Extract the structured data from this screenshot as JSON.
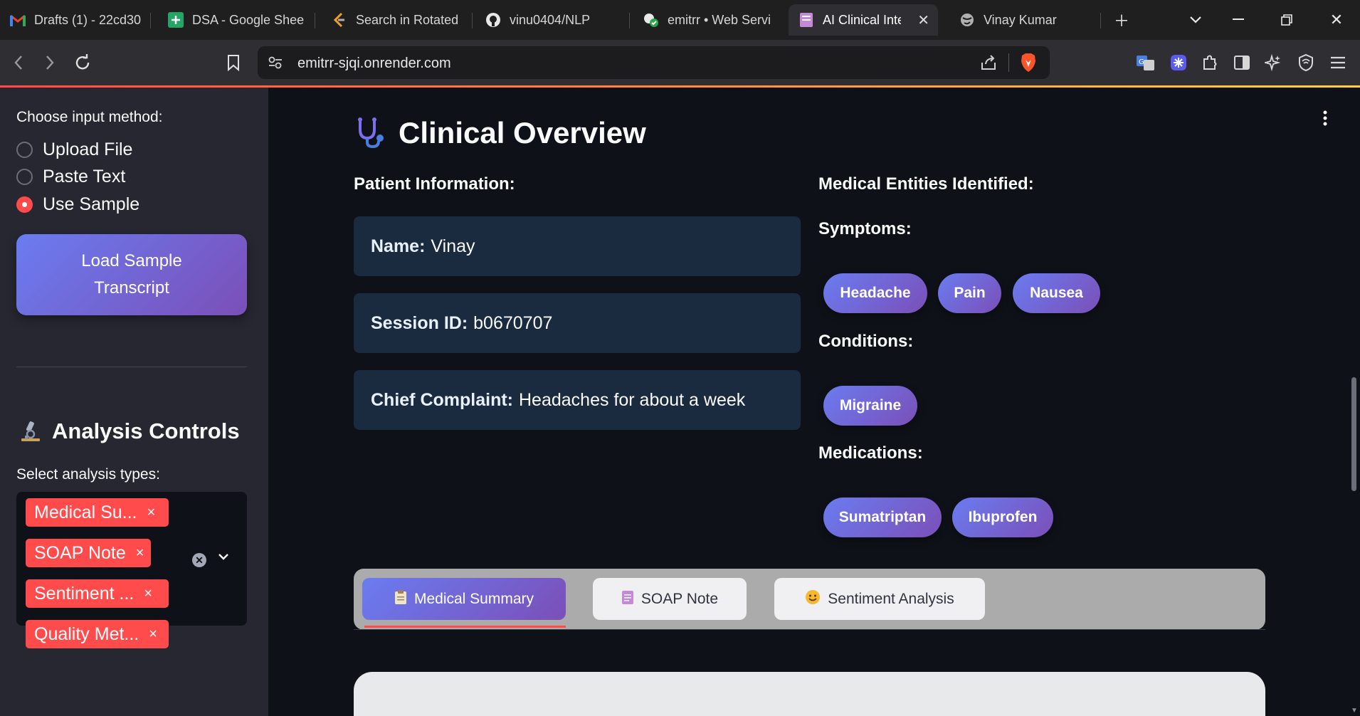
{
  "browser": {
    "tabs": [
      {
        "title": "Drafts (1) - 22cd30",
        "icon": "gmail-icon"
      },
      {
        "title": "DSA - Google Shee",
        "icon": "google-sheets-icon"
      },
      {
        "title": "Search in Rotated",
        "icon": "leetcode-icon"
      },
      {
        "title": "vinu0404/NLP",
        "icon": "github-icon"
      },
      {
        "title": "emitrr • Web Servi",
        "icon": "render-icon"
      },
      {
        "title": "AI Clinical Inte",
        "icon": "streamlit-icon",
        "active": true
      },
      {
        "title": "Vinay Kumar",
        "icon": "globe-icon"
      }
    ],
    "url": "emitrr-sjqi.onrender.com"
  },
  "sidebar": {
    "input_method_label": "Choose input method:",
    "input_methods": [
      {
        "label": "Upload File",
        "selected": false
      },
      {
        "label": "Paste Text",
        "selected": false
      },
      {
        "label": "Use Sample",
        "selected": true
      }
    ],
    "load_button": "Load Sample Transcript",
    "analysis_heading": "Analysis Controls",
    "analysis_icon": "microscope-icon",
    "analysis_types_label": "Select analysis types:",
    "analysis_types": [
      "Medical Su...",
      "SOAP Note",
      "Sentiment ...",
      "Quality Met..."
    ],
    "chip_remove": "×"
  },
  "main": {
    "title": "Clinical Overview",
    "title_icon": "stethoscope-icon",
    "patient_heading": "Patient Information:",
    "patient": {
      "name_label": "Name:",
      "name": "Vinay",
      "session_label": "Session ID:",
      "session": "b0670707",
      "complaint_label": "Chief Complaint:",
      "complaint": "Headaches for about a week"
    },
    "entities_heading": "Medical Entities Identified:",
    "symptoms_heading": "Symptoms:",
    "symptoms": [
      "Headache",
      "Pain",
      "Nausea"
    ],
    "conditions_heading": "Conditions:",
    "conditions": [
      "Migraine"
    ],
    "medications_heading": "Medications:",
    "medications": [
      "Sumatriptan",
      "Ibuprofen"
    ],
    "tabs": [
      {
        "label": "Medical Summary",
        "icon": "clipboard-icon",
        "active": true
      },
      {
        "label": "SOAP Note",
        "icon": "notepad-icon",
        "active": false
      },
      {
        "label": "Sentiment Analysis",
        "icon": "smile-icon",
        "active": false
      }
    ]
  },
  "colors": {
    "accent": "#ff4b4b",
    "gradient_start": "#6a7cf0",
    "gradient_end": "#7b4fb8",
    "card": "#1a2b40"
  }
}
